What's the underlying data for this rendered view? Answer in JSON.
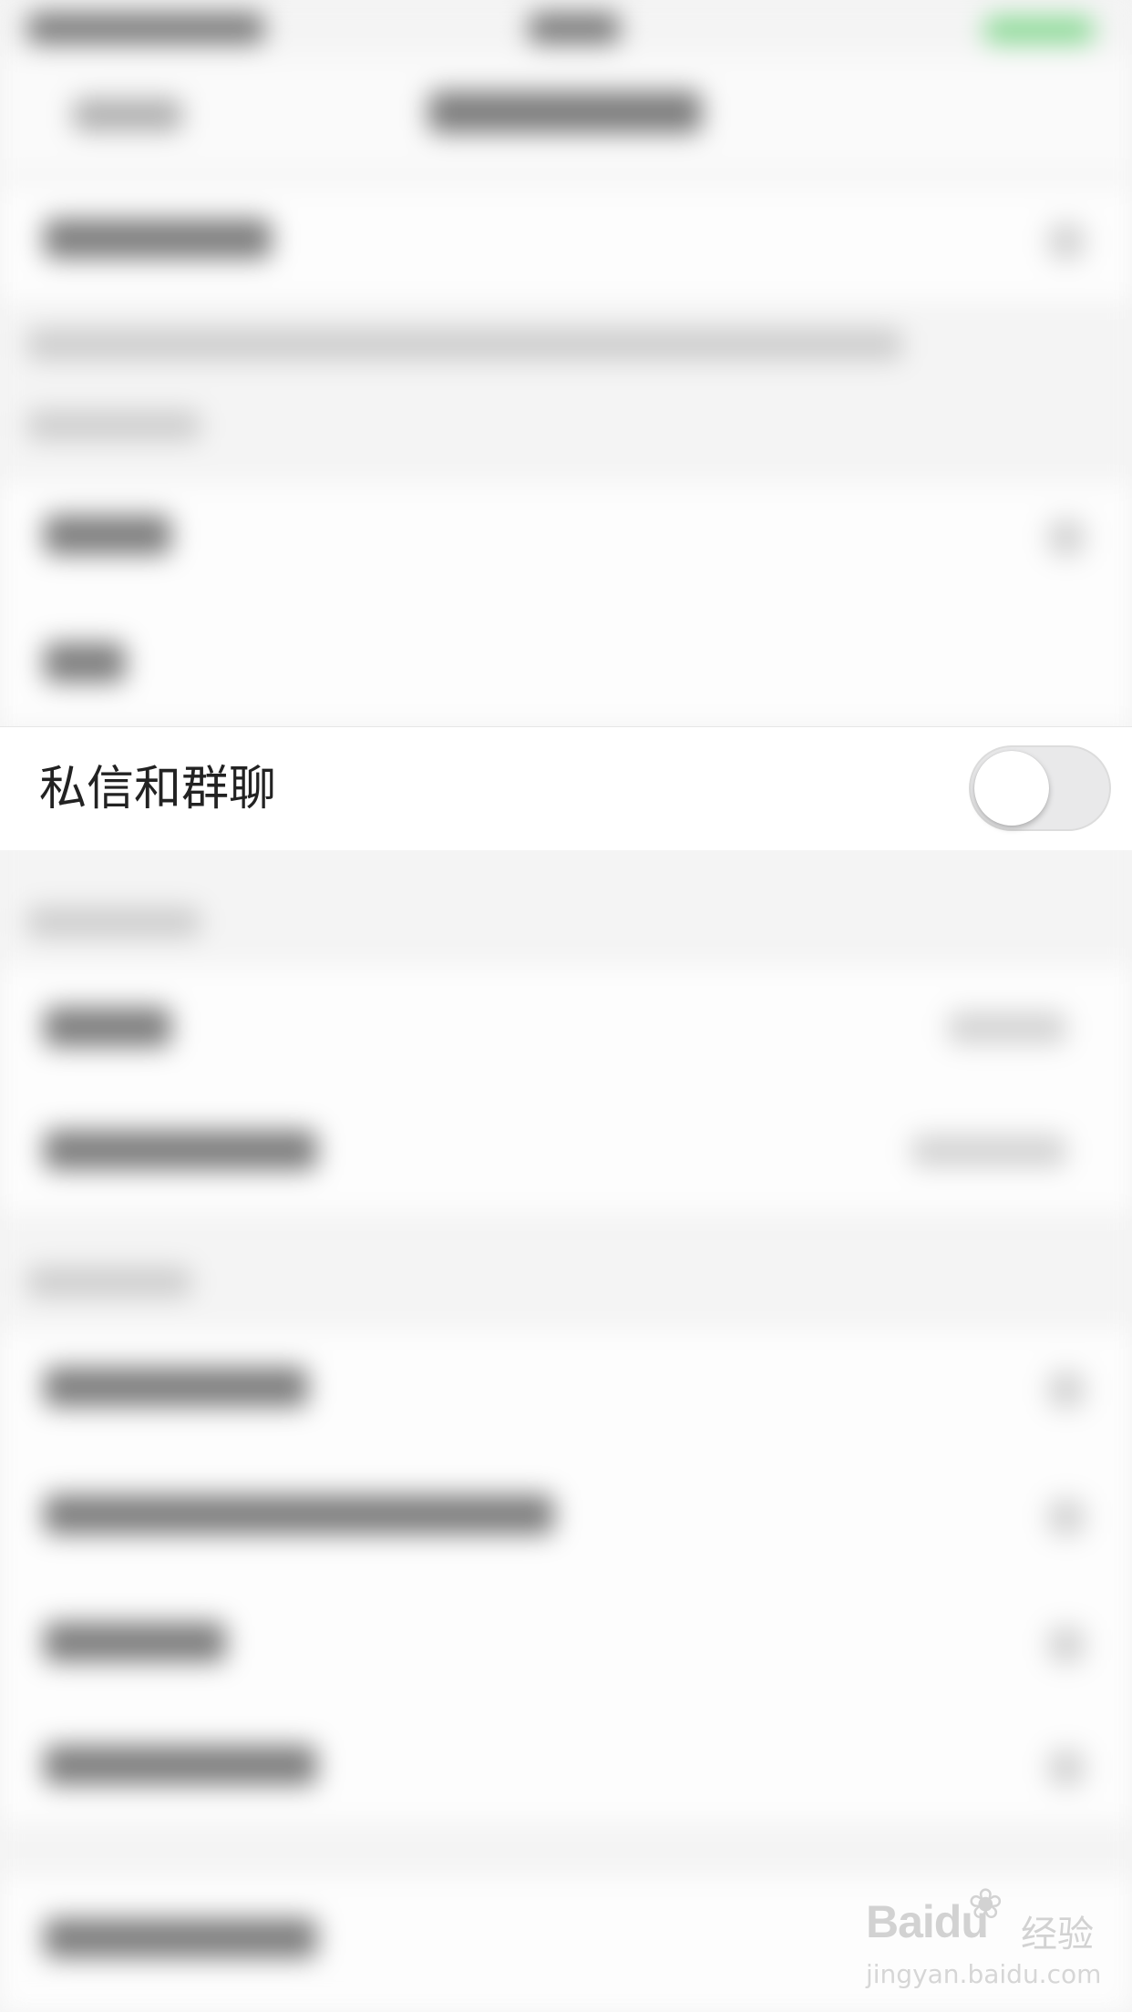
{
  "setting_row": {
    "label": "私信和群聊",
    "toggle_on": false
  },
  "watermark": {
    "logo_text": "Baidu",
    "cn_text": "经验",
    "url": "jingyan.baidu.com"
  },
  "colors": {
    "toggle_off_track": "#e9e9ea",
    "toggle_knob": "#ffffff",
    "label_text": "#222222"
  }
}
